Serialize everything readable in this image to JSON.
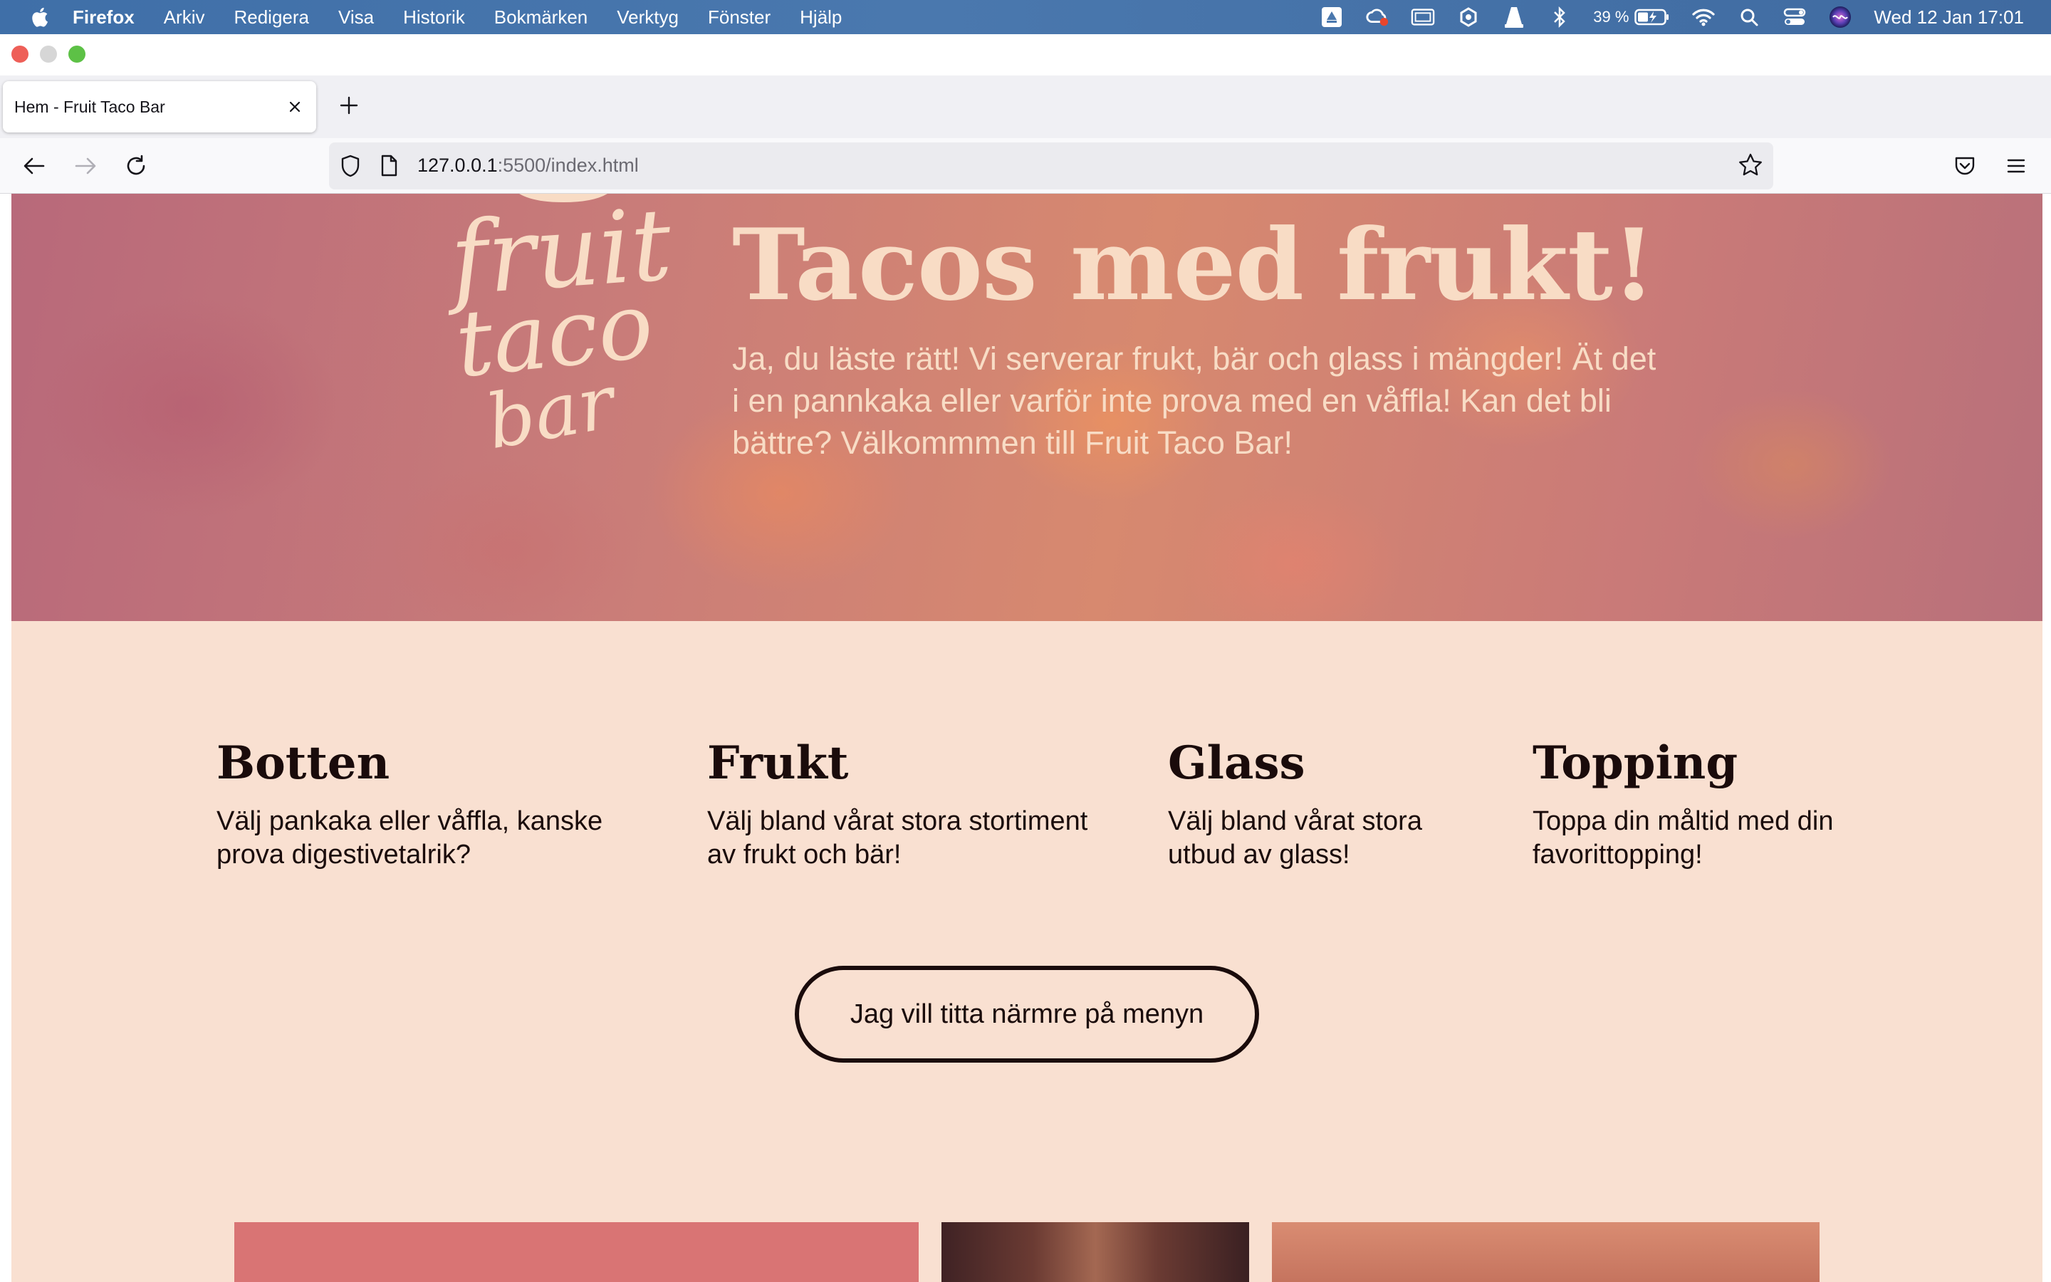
{
  "menubar": {
    "app_name": "Firefox",
    "items": [
      "Arkiv",
      "Redigera",
      "Visa",
      "Historik",
      "Bokmärken",
      "Verktyg",
      "Fönster",
      "Hjälp"
    ],
    "battery": "39 %",
    "clock": "Wed 12 Jan  17:01",
    "status_icons": [
      "google-drive-icon",
      "creative-cloud-icon",
      "display-icon",
      "backup-icon",
      "vlc-icon",
      "bluetooth-icon",
      "battery-icon",
      "wifi-icon",
      "spotlight-icon",
      "control-center-icon",
      "siri-icon"
    ]
  },
  "browser": {
    "tab_title": "Hem - Fruit Taco Bar",
    "url_host": "127.0.0.1",
    "url_rest": ":5500/index.html"
  },
  "hero": {
    "logo_words": [
      "fruit",
      "taco",
      "bar"
    ],
    "title": "Tacos med frukt!",
    "text": "Ja, du läste rätt! Vi serverar frukt, bär och glass i mängder! Ät det i en pannkaka eller varför inte prova med en våffla! Kan det bli bättre? Välkommmen till Fruit Taco Bar!"
  },
  "features": [
    {
      "title": "Botten",
      "text": "Välj pankaka eller våffla, kanske prova digestivetalrik?"
    },
    {
      "title": "Frukt",
      "text": "Välj bland vårat stora stortiment av frukt och bär!"
    },
    {
      "title": "Glass",
      "text": "Välj bland vårat stora utbud av glass!"
    },
    {
      "title": "Topping",
      "text": "Toppa din måltid med din favorittopping!"
    }
  ],
  "cta": {
    "label": "Jag vill titta närmre på menyn"
  },
  "colors": {
    "page_bg": "#f9e0d1",
    "text_dark": "#1a0b0b",
    "hero_text": "#f8dcc5",
    "menubar": "#4a78ae"
  }
}
